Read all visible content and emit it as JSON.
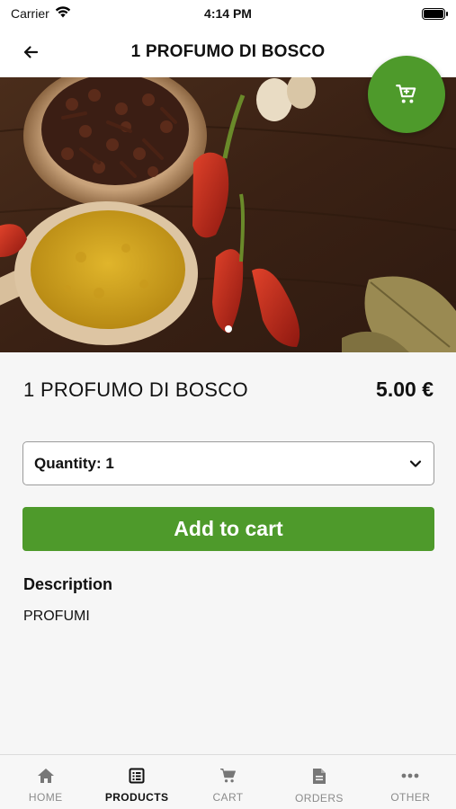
{
  "status_bar": {
    "carrier": "Carrier",
    "time": "4:14 PM"
  },
  "header": {
    "title": "1 PROFUMO DI BOSCO",
    "back_icon": "arrow-left-icon"
  },
  "hero": {
    "image": "spices-on-wooden-table",
    "active_slide": 1,
    "total_slides": 1
  },
  "cart_fab": {
    "icon": "shopping-cart-icon",
    "color": "#4e9a2b"
  },
  "product": {
    "name": "1 PROFUMO DI BOSCO",
    "price": "5.00 €"
  },
  "quantity": {
    "label": "Quantity: 1",
    "value": 1,
    "icon": "chevron-down-icon"
  },
  "add_to_cart": {
    "label": "Add to cart",
    "color": "#4e9a2b"
  },
  "description": {
    "title": "Description",
    "text": "PROFUMI"
  },
  "tabbar": {
    "items": [
      {
        "label": "HOME",
        "icon": "home-icon",
        "active": false
      },
      {
        "label": "PRODUCTS",
        "icon": "list-icon",
        "active": true
      },
      {
        "label": "CART",
        "icon": "cart-icon",
        "active": false
      },
      {
        "label": "ORDERS",
        "icon": "document-icon",
        "active": false
      },
      {
        "label": "OTHER",
        "icon": "more-icon",
        "active": false
      }
    ]
  }
}
